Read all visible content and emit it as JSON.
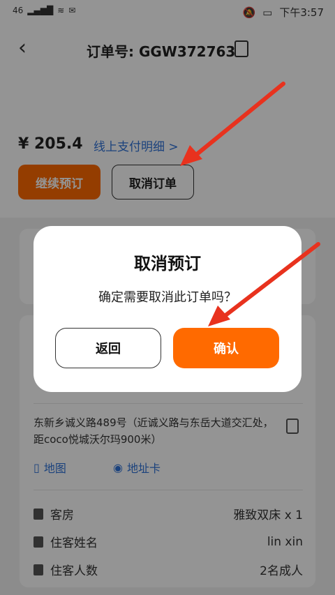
{
  "status_bar": {
    "signal": "46",
    "time": "下午3:57"
  },
  "header": {
    "title": "订单号: GGW372763"
  },
  "order": {
    "price": "¥ 205.4",
    "pay_detail_link": "线上支付明细 >",
    "continue_button": "继续预订",
    "cancel_order_button": "取消订单"
  },
  "hotel": {
    "address": "东新乡诚义路489号（近诚义路与东岳大道交汇处，距coco悦城沃尔玛900米）",
    "map_link": "地图",
    "address_card_link": "地址卡",
    "rows": [
      {
        "label": "客房",
        "value": "雅致双床 x 1"
      },
      {
        "label": "住客姓名",
        "value": "lin xin"
      },
      {
        "label": "住客人数",
        "value": "2名成人"
      }
    ]
  },
  "dialog": {
    "title": "取消预订",
    "message": "确定需要取消此订单吗？",
    "back_button": "返回",
    "confirm_button": "确认"
  },
  "colors": {
    "accent": "#ff6a00",
    "link": "#2f72d8",
    "arrow": "#e8321e"
  }
}
